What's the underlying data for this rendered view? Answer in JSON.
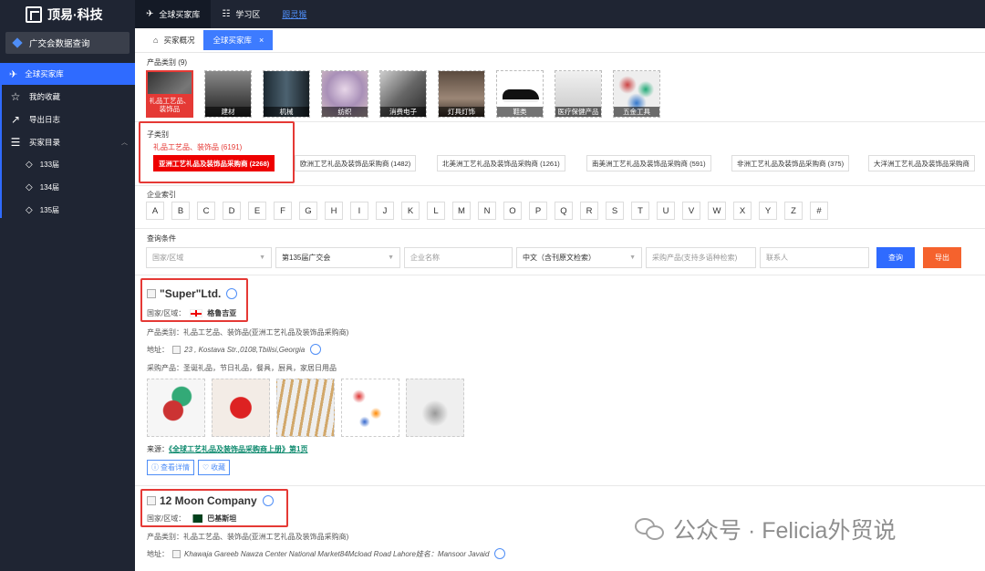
{
  "app": {
    "logo": "顶易·科技"
  },
  "topnav": [
    {
      "label": "全球买家库"
    },
    {
      "label": "学习区"
    },
    {
      "label": "跟灵猴"
    }
  ],
  "sidebar": {
    "dept": "广交会数据查询",
    "active": "全球买家库",
    "items": [
      {
        "label": "我的收藏"
      },
      {
        "label": "导出日志"
      },
      {
        "label": "买家目录"
      }
    ],
    "subs": [
      {
        "label": "133届"
      },
      {
        "label": "134届"
      },
      {
        "label": "135届"
      }
    ]
  },
  "tabs": [
    {
      "label": "买家概况"
    },
    {
      "label": "全球买家库"
    }
  ],
  "product_cats": {
    "label": "产品类别 (9)",
    "items": [
      {
        "label": "礼品工艺品、装饰品"
      },
      {
        "label": "建材"
      },
      {
        "label": "机械"
      },
      {
        "label": "纺织"
      },
      {
        "label": "消费电子"
      },
      {
        "label": "灯具灯饰"
      },
      {
        "label": "鞋类"
      },
      {
        "label": "医疗保健产品"
      },
      {
        "label": "五金工具"
      }
    ]
  },
  "sub_cats": {
    "label": "子类别",
    "title": "礼品工艺品、装饰品 (6191)",
    "items": [
      {
        "label": "亚洲工艺礼品及装饰品采购商 (2268)"
      },
      {
        "label": "欧洲工艺礼品及装饰品采购商 (1482)"
      },
      {
        "label": "北美洲工艺礼品及装饰品采购商 (1261)"
      },
      {
        "label": "南美洲工艺礼品及装饰品采购商 (591)"
      },
      {
        "label": "非洲工艺礼品及装饰品采购商 (375)"
      },
      {
        "label": "大洋洲工艺礼品及装饰品采购商"
      }
    ]
  },
  "index": {
    "label": "企业索引",
    "letters": [
      "A",
      "B",
      "C",
      "D",
      "E",
      "F",
      "G",
      "H",
      "I",
      "J",
      "K",
      "L",
      "M",
      "N",
      "O",
      "P",
      "Q",
      "R",
      "S",
      "T",
      "U",
      "V",
      "W",
      "X",
      "Y",
      "Z",
      "#"
    ]
  },
  "filters": {
    "label": "查询条件",
    "country": "国家/区域",
    "session": "第135届广交会",
    "company_placeholder": "企业名称",
    "lang": "中文（含刊原文检索）",
    "product_placeholder": "采购产品(支持多语种检索)",
    "contact_placeholder": "联系人",
    "search": "查询",
    "export": "导出"
  },
  "companies": [
    {
      "name": "\"Super\"Ltd.",
      "country_label": "国家/区域：",
      "country": "格鲁吉亚",
      "category_line": "产品类别：礼品工艺品、装饰品(亚洲工艺礼品及装饰品采购商)",
      "address_label": "地址：",
      "address": "23 , Kostava Str.,0108,Tbilisi,Georgia",
      "purchase_line": "采购产品：圣诞礼品，节日礼品，餐具，厨具，家居日用品",
      "source_label": "来源：",
      "source_link": "《全球工艺礼品及装饰品采购商上册》第1页",
      "detail_btn": "查看详情",
      "fav_btn": "收藏"
    },
    {
      "name": "12 Moon Company",
      "country_label": "国家/区域：",
      "country": "巴基斯坦",
      "category_line": "产品类别：礼品工艺品、装饰品(亚洲工艺礼品及装饰品采购商)",
      "address_label": "地址：",
      "address": "Khawaja Gareeb Nawza Center National Market84Mcload Road Lahore娃名：Mansoor Javaid"
    }
  ],
  "watermark": "公众号 · Felicia外贸说"
}
